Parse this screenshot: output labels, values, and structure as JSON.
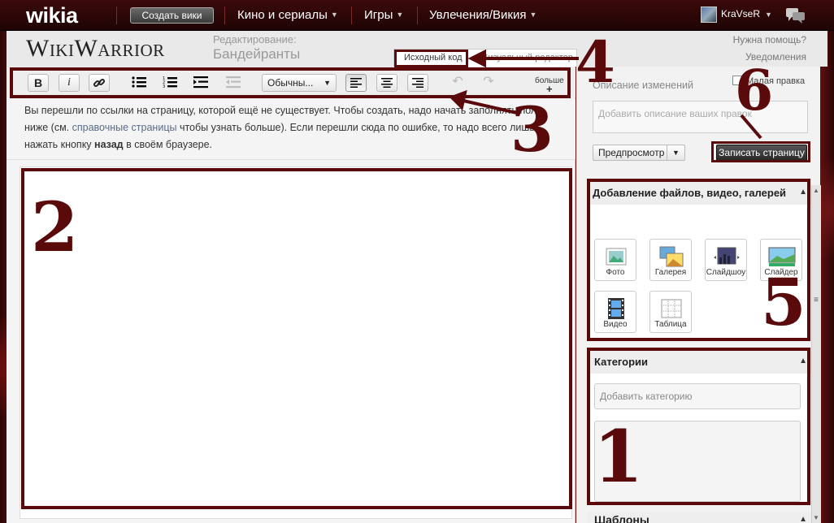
{
  "globalnav": {
    "logo": "wikia",
    "create_wiki": "Создать вики",
    "items": [
      {
        "label": "Кино и сериалы"
      },
      {
        "label": "Игры"
      },
      {
        "label": "Увлечения/Викия"
      }
    ],
    "username": "KraVseR"
  },
  "wiki": {
    "wordmark": "WikiWarrior",
    "edit_label": "Редактирование:",
    "page_title": "Бандейранты",
    "help": "Нужна помощь?",
    "notifications": "Уведомления",
    "mode_source": "Исходный код",
    "mode_visual": "Визуальный редактор"
  },
  "toolbar": {
    "bold": "B",
    "italic": "i",
    "format": "Обычны...",
    "more": "больше",
    "more_plus": "+"
  },
  "notice": {
    "part1": "Вы перешли по ссылки на страницу, которой ещё не существует. Чтобы создать, надо начать заполнять поле ниже (см. ",
    "link": "справочные страницы",
    "part2": " чтобы узнать больше). Если перешли сюда по ошибке, то надо всего лишь нажать кнопку ",
    "bold": "назад",
    "part3": " в своём браузере."
  },
  "rail": {
    "summary_label": "Описание изменений",
    "minor_edit": "Малая правка",
    "summary_placeholder": "Добавить описание ваших правок",
    "preview": "Предпросмотр",
    "save": "Записать страницу",
    "media": {
      "title": "Добавление файлов, видео, галерей",
      "tiles": [
        {
          "label": "Фото",
          "icon": "photo-icon"
        },
        {
          "label": "Галерея",
          "icon": "gallery-icon"
        },
        {
          "label": "Слайдшоу",
          "icon": "slideshow-icon"
        },
        {
          "label": "Слайдер",
          "icon": "slider-icon"
        },
        {
          "label": "Видео",
          "icon": "video-icon"
        },
        {
          "label": "Таблица",
          "icon": "table-icon"
        }
      ]
    },
    "categories": {
      "title": "Категории",
      "placeholder": "Добавить категорию"
    },
    "templates": {
      "title": "Шаблоны"
    }
  },
  "annotations": [
    "1",
    "2",
    "3",
    "4",
    "5",
    "6"
  ],
  "colors": {
    "annotation": "#5a0a0a",
    "nav_bg": "#2a0606"
  }
}
